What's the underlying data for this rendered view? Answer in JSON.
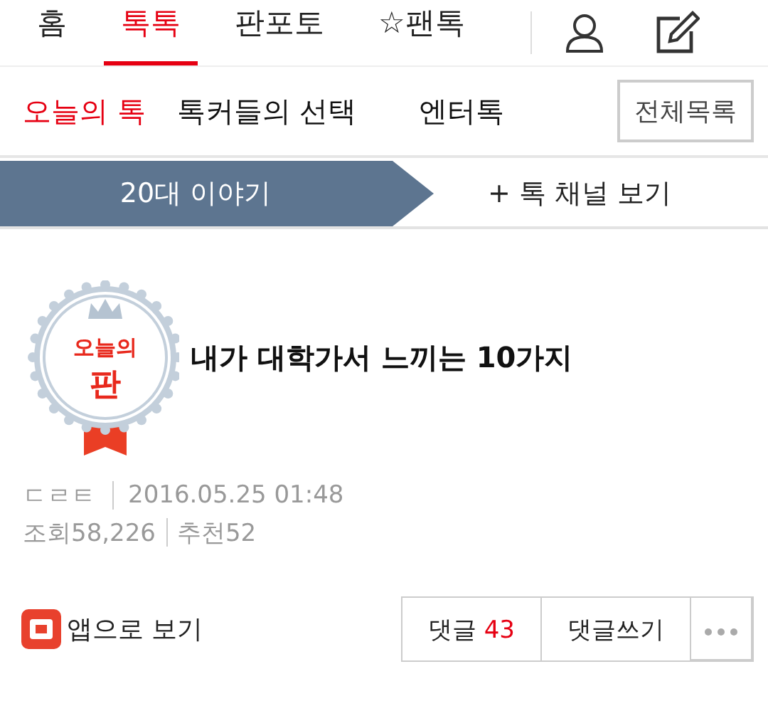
{
  "nav": {
    "tabs": [
      {
        "label": "홈",
        "selected": false
      },
      {
        "label": "톡톡",
        "selected": true
      },
      {
        "label": "판포토",
        "selected": false
      },
      {
        "label": "☆팬톡",
        "selected": false
      }
    ]
  },
  "subnav": {
    "tabs": [
      {
        "label": "오늘의 톡",
        "selected": true
      },
      {
        "label": "톡커들의 선택",
        "selected": false
      },
      {
        "label": "엔터톡",
        "selected": false
      }
    ],
    "all_button": "전체목록"
  },
  "channel_bar": {
    "title": "20대 이야기",
    "link": "+ 톡 채널 보기"
  },
  "post": {
    "badge": {
      "line1": "오늘의",
      "line2": "판"
    },
    "title": "내가 대학가서 느끼는 10가지",
    "author": "ㄷㄹㅌ",
    "date": "2016.05.25 01:48",
    "views_label": "조회",
    "views": "58,226",
    "likes_label": "추천",
    "likes": "52"
  },
  "footer": {
    "app_link": "앱으로 보기",
    "comments_label": "댓글",
    "comments_count": "43",
    "write_button": "댓글쓰기"
  }
}
